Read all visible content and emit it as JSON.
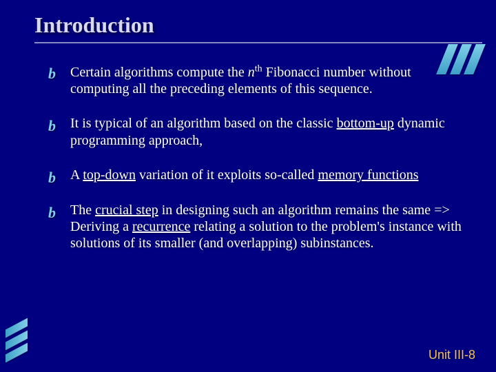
{
  "title": "Introduction",
  "bullets": [
    {
      "html": "Certain algorithms compute the <i>n</i><sup>th</sup> Fibonacci number without computing all the preceding elements of this sequence."
    },
    {
      "html": "It is typical of an algorithm based on the classic <span class=\"ul\">bottom-up</span> dynamic programming approach,"
    },
    {
      "html": "A <span class=\"ul\">top-down</span> variation of it exploits so-called <span class=\"ul\">memory functions</span>"
    },
    {
      "html": "The <span class=\"ul\">crucial step</span> in designing such an algorithm remains the same =&gt; Deriving a <span class=\"ul\">recurrence</span> relating a solution to the problem's instance with solutions of its smaller (and overlapping) subinstances."
    }
  ],
  "bullet_glyph": "b",
  "footer": "Unit III-8"
}
